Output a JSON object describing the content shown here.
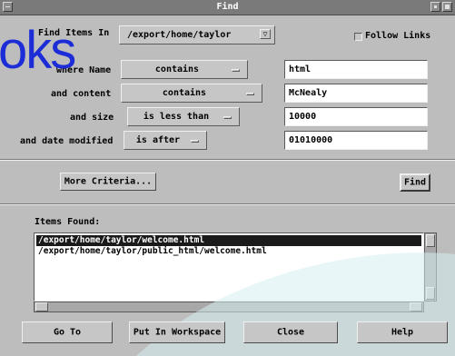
{
  "window": {
    "title": "Find"
  },
  "find_in": {
    "label": "Find Items In",
    "path": "/export/home/taylor",
    "follow_links_label": "Follow Links"
  },
  "criteria": [
    {
      "label": "where Name",
      "operator": "contains",
      "value": "html"
    },
    {
      "label": "and content",
      "operator": "contains",
      "value": "McNealy"
    },
    {
      "label": "and size",
      "operator": "is less than",
      "value": "10000"
    },
    {
      "label": "and date modified",
      "operator": "is after",
      "value": "01010000"
    }
  ],
  "more_criteria_label": "More Criteria...",
  "find_button_label": "Find",
  "results": {
    "label": "Items Found:",
    "items": [
      "/export/home/taylor/welcome.html",
      "/export/home/taylor/public_html/welcome.html"
    ]
  },
  "buttons": {
    "goto": "Go To",
    "put_in_workspace": "Put In Workspace",
    "close": "Close",
    "help": "Help"
  },
  "watermark_text": "oks",
  "colors": {
    "watermark": "#1c2cd6",
    "swoosh": "#d6eef2"
  }
}
